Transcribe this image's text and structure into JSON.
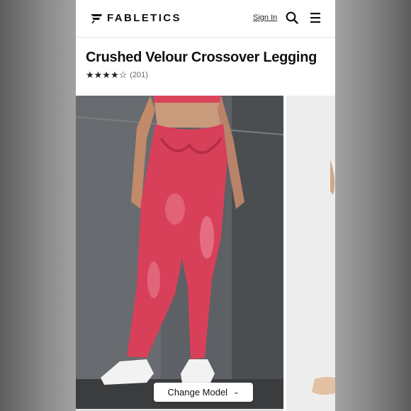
{
  "nav": {
    "brand": "FABLETICS",
    "sign_in": "Sign In"
  },
  "product": {
    "title": "Crushed Velour Crossover Legging",
    "rating_stars": 4.5,
    "stars_display": "★★★★",
    "star_half": "☆",
    "review_count": "(201)"
  },
  "gallery": {
    "change_model_label": "Change Model"
  },
  "colors": {
    "legging": "#d9455a",
    "background_wall": "#5c5f63",
    "accent": "#111111"
  }
}
